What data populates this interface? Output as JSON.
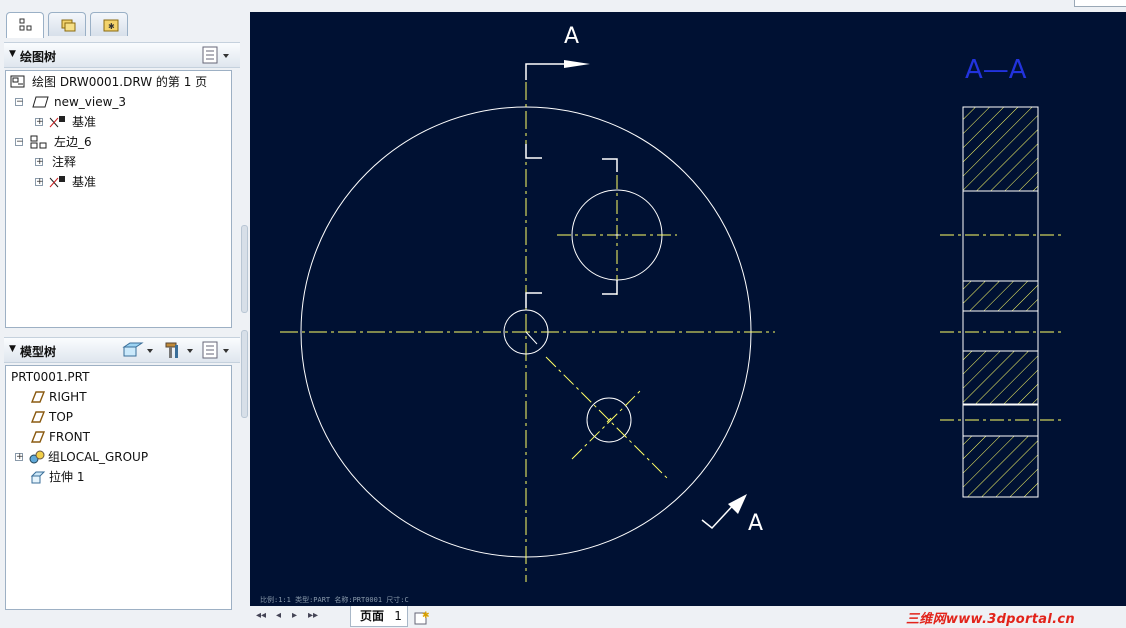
{
  "drawing_tree": {
    "title": "绘图树",
    "items": [
      {
        "label": "绘图 DRW0001.DRW 的第 1 页"
      },
      {
        "label": "new_view_3"
      },
      {
        "label": "基准"
      },
      {
        "label": "左边_6"
      },
      {
        "label": "注释"
      },
      {
        "label": "基准"
      }
    ]
  },
  "model_tree": {
    "title": "模型树",
    "items": [
      {
        "label": "PRT0001.PRT"
      },
      {
        "label": "RIGHT"
      },
      {
        "label": "TOP"
      },
      {
        "label": "FRONT"
      },
      {
        "label": "组LOCAL_GROUP"
      },
      {
        "label": "拉伸 1"
      }
    ]
  },
  "drawing": {
    "section_label_top": "A",
    "section_label_bottom": "A",
    "section_view_title": "A—A",
    "status_text": "比例:1:1    类型:PART    名称:PRT0001    尺寸:C"
  },
  "page_bar": {
    "page_label": "页面",
    "page_number": "1"
  },
  "watermark": "三维网www.3dportal.cn",
  "colors": {
    "drawing_background": "#001133",
    "geometry": "#ffffff",
    "centerline": "#ffff66",
    "section_title": "#2233dd"
  }
}
